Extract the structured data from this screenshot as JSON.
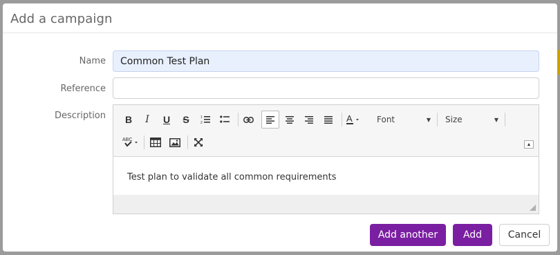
{
  "dialog": {
    "title": "Add a campaign"
  },
  "form": {
    "name_label": "Name",
    "name_value": "Common Test Plan",
    "reference_label": "Reference",
    "reference_value": "",
    "description_label": "Description"
  },
  "editor": {
    "toolbar": {
      "bold": "B",
      "italic": "I",
      "underline": "U",
      "strike": "S",
      "font_label": "Font",
      "size_label": "Size",
      "icons": [
        "bold-icon",
        "italic-icon",
        "underline-icon",
        "strikethrough-icon",
        "numbered-list-icon",
        "bulleted-list-icon",
        "link-icon",
        "align-left-icon",
        "align-center-icon",
        "align-right-icon",
        "justify-icon",
        "text-color-icon",
        "spellcheck-icon",
        "table-icon",
        "image-icon",
        "maximize-icon",
        "collapse-toolbar-icon"
      ]
    },
    "content": "Test plan to validate all common requirements"
  },
  "buttons": {
    "add_another": "Add another",
    "add": "Add",
    "cancel": "Cancel"
  },
  "colors": {
    "primary": "#7b1fa2",
    "name_field_bg": "#e8f0fe"
  }
}
